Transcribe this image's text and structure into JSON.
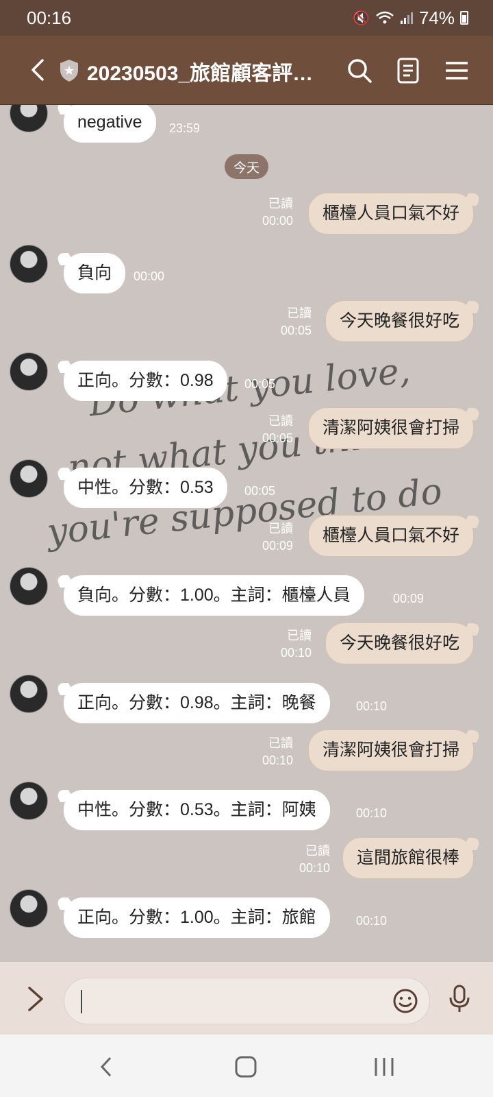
{
  "status_bar": {
    "time": "00:16",
    "battery": "74%"
  },
  "header": {
    "title": "20230503_旅館顧客評…"
  },
  "chat": {
    "date_separator": "今天",
    "messages": [
      {
        "dir": "in",
        "text": "negative",
        "time": "23:59"
      },
      {
        "dir": "out",
        "text": "櫃檯人員口氣不好",
        "read": "已讀",
        "time": "00:00"
      },
      {
        "dir": "in",
        "text": "負向",
        "time": "00:00"
      },
      {
        "dir": "out",
        "text": "今天晚餐很好吃",
        "read": "已讀",
        "time": "00:05"
      },
      {
        "dir": "in",
        "text": "正向。分數：0.98",
        "time": "00:05"
      },
      {
        "dir": "out",
        "text": "清潔阿姨很會打掃",
        "read": "已讀",
        "time": "00:05"
      },
      {
        "dir": "in",
        "text": "中性。分數：0.53",
        "time": "00:05"
      },
      {
        "dir": "out",
        "text": "櫃檯人員口氣不好",
        "read": "已讀",
        "time": "00:09"
      },
      {
        "dir": "in",
        "text": "負向。分數：1.00。主詞：櫃檯人員",
        "time": "00:09"
      },
      {
        "dir": "out",
        "text": "今天晚餐很好吃",
        "read": "已讀",
        "time": "00:10"
      },
      {
        "dir": "in",
        "text": "正向。分數：0.98。主詞：晚餐",
        "time": "00:10"
      },
      {
        "dir": "out",
        "text": "清潔阿姨很會打掃",
        "read": "已讀",
        "time": "00:10"
      },
      {
        "dir": "in",
        "text": "中性。分數：0.53。主詞：阿姨",
        "time": "00:10"
      },
      {
        "dir": "out",
        "text": "這間旅館很棒",
        "read": "已讀",
        "time": "00:10"
      },
      {
        "dir": "in",
        "text": "正向。分數：1.00。主詞：旅館",
        "time": "00:10"
      }
    ]
  },
  "background_text": "Do what you love, not what you think you're supposed to do",
  "colors": {
    "header": "#6f4e3b",
    "status_bar": "#5f4638",
    "chat_bg": "#cbc4c1",
    "outgoing_bubble": "#ebdccd",
    "incoming_bubble": "#ffffff"
  },
  "icons": [
    "back-arrow-icon",
    "shield-icon",
    "search-icon",
    "notes-icon",
    "menu-icon",
    "expand-icon",
    "emoji-icon",
    "microphone-icon"
  ]
}
